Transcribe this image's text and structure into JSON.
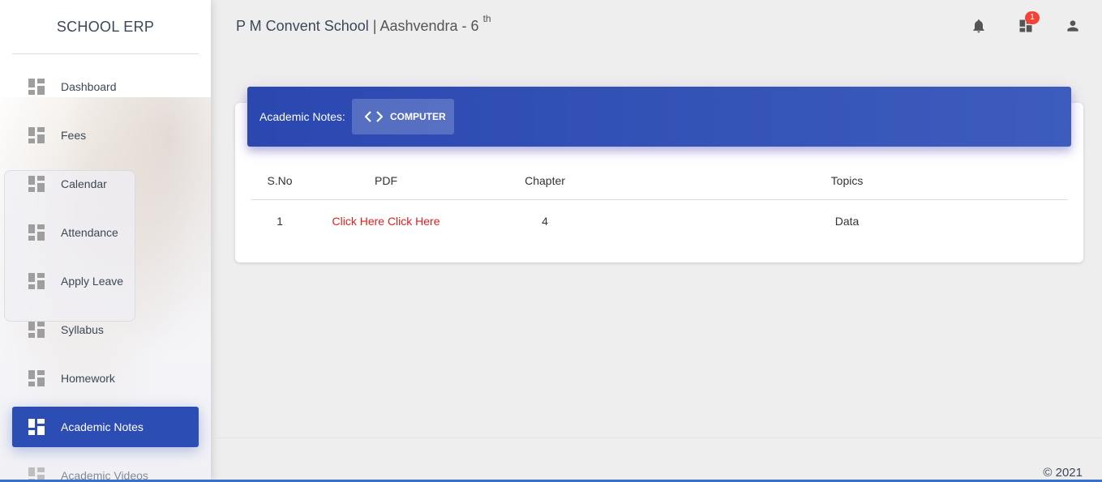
{
  "app": {
    "title": "SCHOOL ERP"
  },
  "header": {
    "school": "P M Convent School",
    "separator": "|",
    "student": "Aashvendra - 6",
    "grade_suffix": "th",
    "notification_count": "1",
    "icons": [
      "bell-icon",
      "dashboard-icon",
      "person-icon"
    ]
  },
  "sidebar": {
    "items": [
      {
        "label": "Dashboard"
      },
      {
        "label": "Fees"
      },
      {
        "label": "Calendar"
      },
      {
        "label": "Attendance"
      },
      {
        "label": "Apply Leave"
      },
      {
        "label": "Syllabus"
      },
      {
        "label": "Homework"
      },
      {
        "label": "Academic Notes",
        "active": true
      },
      {
        "label": "Academic Videos"
      }
    ]
  },
  "notes": {
    "label": "Academic Notes:",
    "subject_tab": "COMPUTER",
    "columns": [
      "S.No",
      "PDF",
      "Chapter",
      "Topics"
    ],
    "rows": [
      {
        "sno": "1",
        "pdf": "Click Here Click Here",
        "chapter": "4",
        "topics": "Data"
      }
    ]
  },
  "footer": {
    "copyright": "© 2021"
  },
  "colors": {
    "primary": "#2c4db4",
    "link": "#e01e1e",
    "badge": "#f44336"
  }
}
